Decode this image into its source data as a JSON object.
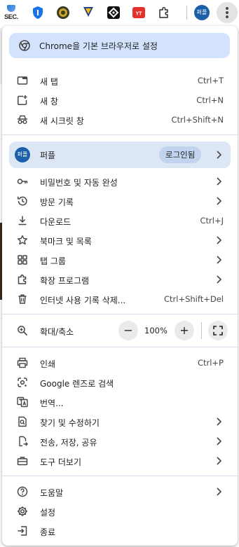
{
  "toolbar": {
    "extensions": [
      {
        "name": "sec-extension",
        "label": "SEC."
      },
      {
        "name": "shield-extension"
      },
      {
        "name": "gear-coin-extension"
      },
      {
        "name": "download-arrow-extension"
      },
      {
        "name": "diamond-extension"
      },
      {
        "name": "youtube-extension",
        "label": "YT"
      },
      {
        "name": "puzzle-extensions-icon"
      }
    ],
    "profile_initials": "퍼플",
    "menu_button": "more-vert-icon"
  },
  "menu": {
    "default_browser_banner": "Chrome을 기본 브라우저로 설정",
    "new_tab": {
      "label": "새 탭",
      "shortcut": "Ctrl+T"
    },
    "new_window": {
      "label": "새 창",
      "shortcut": "Ctrl+N"
    },
    "incognito": {
      "label": "새 시크릿 창",
      "shortcut": "Ctrl+Shift+N"
    },
    "profile": {
      "initials": "퍼플",
      "name": "퍼플",
      "status": "로그인됨"
    },
    "passwords": {
      "label": "비밀번호 및 자동 완성"
    },
    "history": {
      "label": "방문 기록"
    },
    "downloads": {
      "label": "다운로드",
      "shortcut": "Ctrl+J"
    },
    "bookmarks": {
      "label": "북마크 및 목록"
    },
    "tab_groups": {
      "label": "탭 그룹"
    },
    "extensions": {
      "label": "확장 프로그램"
    },
    "clear_data": {
      "label": "인터넷 사용 기록 삭제...",
      "shortcut": "Ctrl+Shift+Del"
    },
    "zoom": {
      "label": "확대/축소",
      "minus": "−",
      "value": "100%",
      "plus": "+"
    },
    "print": {
      "label": "인쇄",
      "shortcut": "Ctrl+P"
    },
    "lens": {
      "label": "Google 렌즈로 검색"
    },
    "translate": {
      "label": "번역..."
    },
    "find_edit": {
      "label": "찾기 및 수정하기"
    },
    "cast_save_share": {
      "label": "전송, 저장, 공유"
    },
    "more_tools": {
      "label": "도구 더보기"
    },
    "help": {
      "label": "도움말"
    },
    "settings": {
      "label": "설정"
    },
    "exit": {
      "label": "종료"
    }
  },
  "colors": {
    "banner_bg": "#d3e3fd",
    "profile_bg": "#dde6f4",
    "avatar": "#1a5fa8",
    "icon": "#444746",
    "divider": "#d7e1ec"
  }
}
